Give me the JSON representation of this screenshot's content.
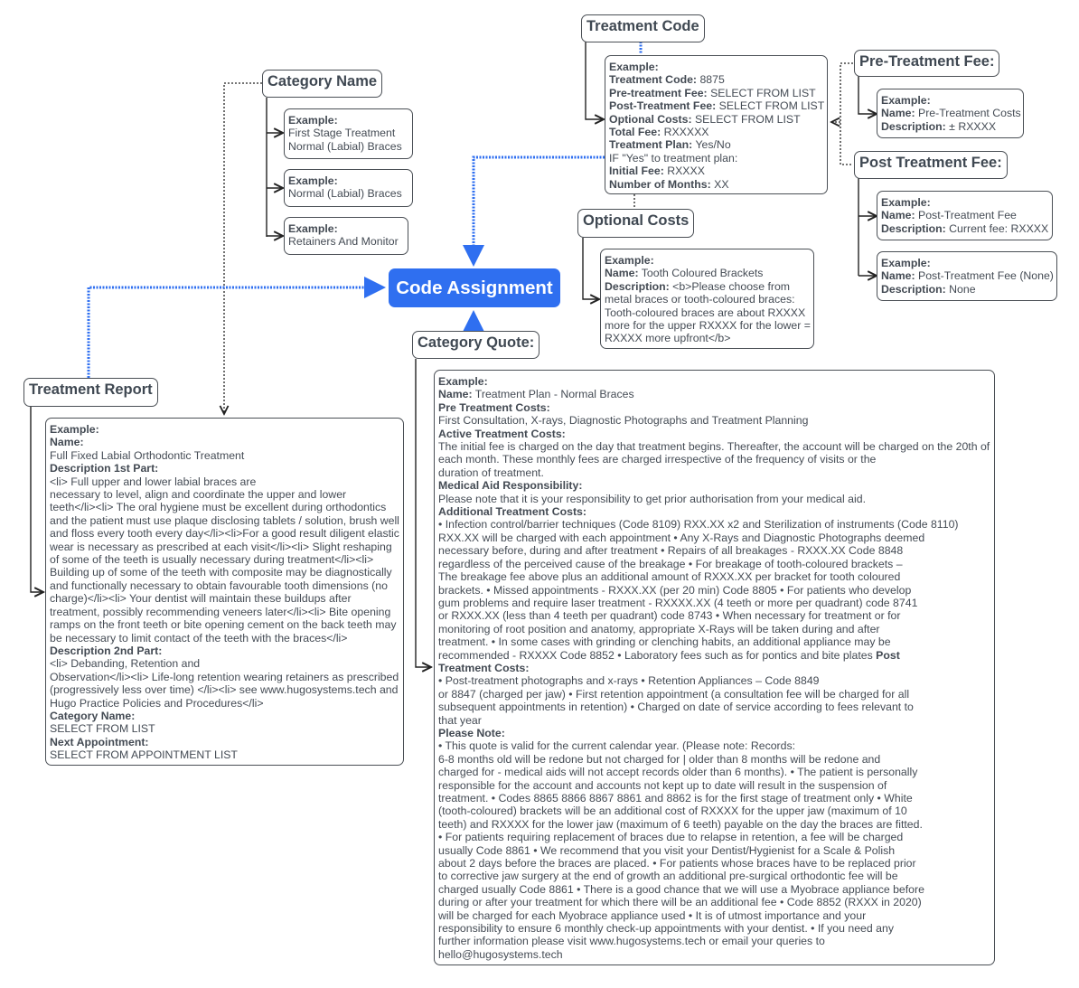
{
  "center": {
    "label": "Code Assignment"
  },
  "category_name": {
    "title": "Category Name",
    "examples": [
      {
        "heading": "Example:",
        "lines": [
          "First Stage Treatment",
          "Normal (Labial) Braces"
        ]
      },
      {
        "heading": "Example:",
        "lines": [
          "Normal (Labial) Braces"
        ]
      },
      {
        "heading": "Example:",
        "lines": [
          "Retainers And Monitor"
        ]
      }
    ]
  },
  "treatment_code": {
    "title": "Treatment Code",
    "heading": "Example:",
    "fields": [
      {
        "label": "Treatment Code:",
        "value": " 8875"
      },
      {
        "label": "Pre-treatment Fee:",
        "value": " SELECT FROM LIST"
      },
      {
        "label": "Post-Treatment Fee:",
        "value": " SELECT FROM LIST"
      },
      {
        "label": "Optional Costs:",
        "value": " SELECT FROM LIST"
      },
      {
        "label": "Total Fee:",
        "value": " RXXXXX"
      },
      {
        "label": "Treatment Plan:",
        "value": " Yes/No"
      },
      {
        "label": "",
        "value": "IF \"Yes\" to treatment plan:"
      },
      {
        "label": "Initial Fee:",
        "value": " RXXXX"
      },
      {
        "label": "Number of Months:",
        "value": " XX"
      }
    ]
  },
  "pre_treatment_fee": {
    "title": "Pre-Treatment Fee:",
    "example": {
      "heading": "Example:",
      "name_label": "Name:",
      "name": " Pre-Treatment Costs",
      "desc_label": "Description:",
      "desc": " ± RXXXX"
    }
  },
  "post_treatment_fee": {
    "title": "Post Treatment Fee:",
    "examples": [
      {
        "heading": "Example:",
        "name_label": "Name:",
        "name": " Post-Treatment Fee",
        "desc_label": "Description:",
        "desc": " Current fee: RXXXX"
      },
      {
        "heading": "Example:",
        "name_label": "Name:",
        "name": " Post-Treatment Fee (None)",
        "desc_label": "Description:",
        "desc": " None"
      }
    ]
  },
  "optional_costs": {
    "title": "Optional Costs",
    "heading": "Example:",
    "name_label": "Name:",
    "name": " Tooth Coloured Brackets",
    "desc_label": "Description:",
    "desc_lines": [
      " <b>Please choose from",
      "metal braces or tooth-coloured braces:",
      "Tooth-coloured braces are about RXXXX",
      "more for the upper RXXXX for the lower =",
      "RXXXX more upfront</b>"
    ]
  },
  "treatment_report": {
    "title": "Treatment Report",
    "heading": "Example:",
    "name_label": "Name:",
    "name": "Full Fixed Labial Orthodontic Treatment",
    "desc1_label": "Description 1st Part:",
    "desc1_lines": [
      "<li> Full upper and lower labial braces are",
      "necessary to level, align and coordinate the upper and lower",
      "teeth</li><li> The oral hygiene must be excellent during orthodontics",
      "and the patient must use plaque disclosing tablets / solution, brush well",
      "and floss every tooth every day</li><li>For a good result diligent elastic",
      "wear is necessary as prescribed at each visit</li><li> Slight reshaping",
      "of some of the teeth is usually necessary during treatment</li><li>",
      "Building up of some of the teeth with composite may be diagnostically",
      "and functionally necessary to obtain favourable tooth dimensions (no",
      "charge)</li><li> Your dentist will maintain these buildups after",
      "treatment, possibly recommending veneers later</li><li> Bite opening",
      "ramps on the front teeth or bite opening cement on the back teeth may",
      "be necessary to limit contact of the teeth with the braces</li>"
    ],
    "desc2_label": "Description 2nd Part:",
    "desc2_lines": [
      "<li> Debanding, Retention and",
      "Observation</li><li> Life-long retention wearing retainers as prescribed",
      "(progressively less over time) </li><li> see www.hugosystems.tech and",
      "Hugo Practice Policies and Procedures</li>"
    ],
    "category_label": "Category Name:",
    "category_value": "SELECT FROM LIST",
    "next_label": "Next Appointment:",
    "next_value": "SELECT FROM APPOINTMENT LIST"
  },
  "category_quote": {
    "title": "Category Quote:",
    "heading": "Example:",
    "name_label": "Name:",
    "name": " Treatment Plan - Normal Braces",
    "pre_label": "Pre Treatment Costs:",
    "pre_lines": [
      "First Consultation, X-rays, Diagnostic Photographs and Treatment Planning"
    ],
    "active_label": "Active Treatment Costs:",
    "active_lines": [
      "The initial fee is charged on the day that treatment begins. Thereafter, the account will be charged on the 20th of",
      "each month. These monthly fees are charged irrespective of the frequency of visits or the",
      "duration of treatment."
    ],
    "medical_label": "Medical Aid Responsibility:",
    "medical_lines": [
      "Please note that it is your responsibility to get prior authorisation from your medical aid."
    ],
    "additional_label": "Additional Treatment Costs:",
    "additional_lines": [
      "• Infection control/barrier techniques (Code 8109) RXX.XX x2 and Sterilization of instruments (Code 8110)",
      "RXX.XX will be charged with each appointment • Any X-Rays and Diagnostic Photographs deemed",
      "necessary before, during and after treatment • Repairs of all breakages - RXXX.XX Code 8848",
      "regardless of the perceived cause of the breakage • For breakage of tooth-coloured brackets –",
      "The breakage fee above plus an additional amount of RXXX.XX per bracket for tooth coloured",
      "brackets. • Missed appointments - RXXX.XX (per 20 min) Code 8805 • For patients who develop",
      "gum problems and require laser treatment - RXXXX.XX (4 teeth or more per quadrant) code 8741",
      "or RXXX.XX (less than 4 teeth per quadrant) code 8743 • When necessary for treatment or for",
      "monitoring of root position and anatomy, appropriate X-Rays will be taken during and after",
      "treatment. • In some cases with grinding or clenching habits, an additional appliance may be"
    ],
    "additional_last": "recommended - RXXXX Code 8852 • Laboratory fees such as for pontics and bite plates ",
    "post_label_a": "Post",
    "post_label_b": "Treatment Costs:",
    "post_lines": [
      "• Post-treatment photographs and x-rays • Retention Appliances – Code 8849",
      "or 8847 (charged per jaw) • First retention appointment (a consultation fee will be charged for all",
      "subsequent appointments in retention) • Charged on date of service according to fees relevant to",
      "that year"
    ],
    "note_label": "Please Note:",
    "note_lines": [
      "• This quote is valid for the current calendar year. (Please note: Records:",
      "6-8 months old will be redone but not charged for | older than 8 months will be redone and",
      "charged for - medical aids will not accept records older than 6 months). • The patient is personally",
      "responsible for the account and accounts not kept up to date will result in the suspension of",
      "treatment. • Codes 8865 8866 8867 8861 and 8862 is for the first stage of treatment only • White",
      "(tooth-coloured) brackets will be an additional cost of RXXXX for the upper jaw (maximum of 10",
      "teeth) and RXXXX for the lower jaw (maximum of 6 teeth) payable on the day the braces are fitted.",
      "• For patients requiring replacement of braces due to relapse in retention, a fee will be charged",
      "usually Code 8861 • We recommend that you visit your Dentist/Hygienist for a Scale & Polish",
      "about 2 days before the braces are placed. • For patients whose braces have to be replaced prior",
      "to corrective jaw surgery at the end of growth an additional pre-surgical orthodontic fee will be",
      "charged usually Code 8861 • There is a good chance that we will use a Myobrace appliance before",
      "during or after your treatment for which there will be an additional fee • Code 8852 (RXXX in 2020)",
      "will be charged for each Myobrace appliance used • It is of utmost importance and your",
      "responsibility to ensure 6 monthly check-up appointments with your dentist. • If you need any",
      "further information please visit www.hugosystems.tech or email your queries to",
      "hello@hugosystems.tech"
    ]
  },
  "colors": {
    "accent": "#2f6ff0",
    "border": "#4a4f55",
    "text": "#444b54",
    "dotted_link": "#2f6ff0"
  }
}
